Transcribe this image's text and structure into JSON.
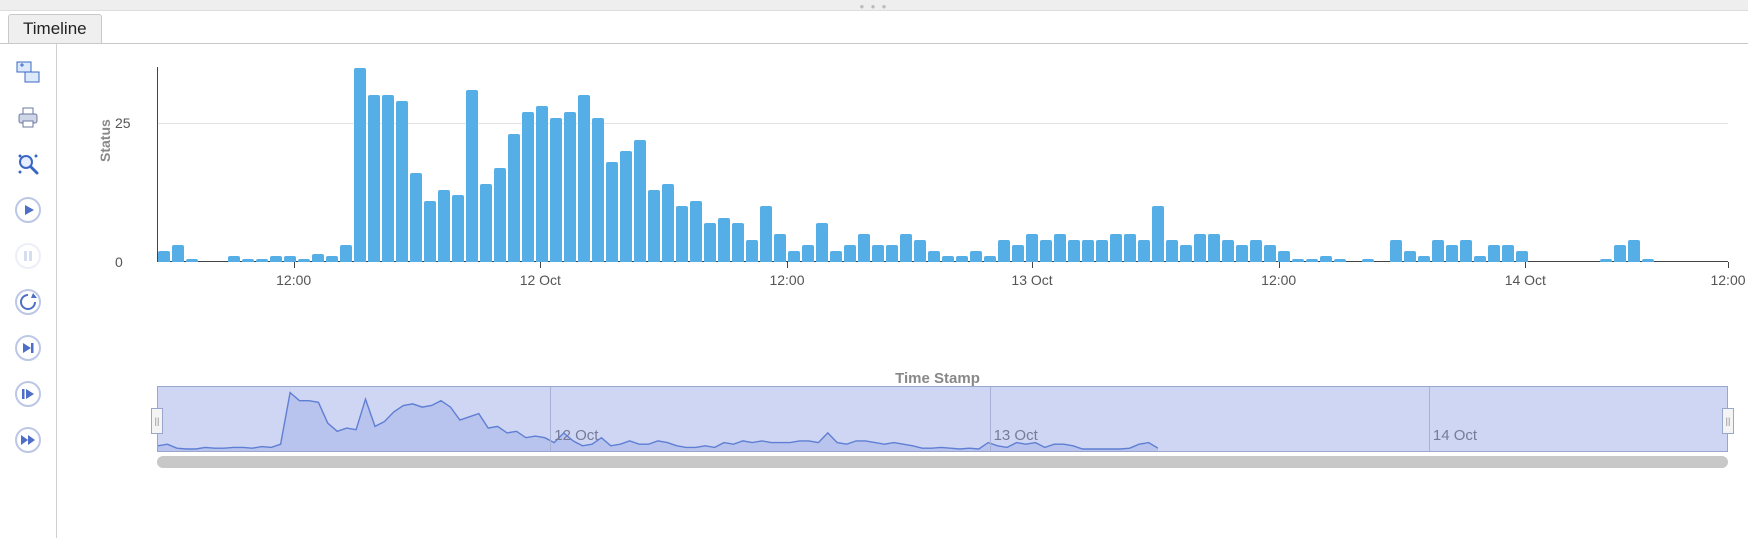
{
  "tab": {
    "label": "Timeline"
  },
  "toolbar": {
    "icons": [
      "screenshot",
      "print",
      "zoom",
      "play",
      "pause",
      "refresh",
      "step-fwd",
      "step-continuous",
      "fast-fwd"
    ]
  },
  "chart_data": {
    "type": "bar",
    "ylabel": "Status",
    "xlabel": "Time Stamp",
    "y_ticks": [
      0,
      25
    ],
    "ylim": [
      0,
      36
    ],
    "x_ticks": [
      {
        "pos_pct": 8.7,
        "label": "12:00"
      },
      {
        "pos_pct": 24.4,
        "label": "12 Oct"
      },
      {
        "pos_pct": 40.1,
        "label": "12:00"
      },
      {
        "pos_pct": 55.7,
        "label": "13 Oct"
      },
      {
        "pos_pct": 71.4,
        "label": "12:00"
      },
      {
        "pos_pct": 87.1,
        "label": "14 Oct"
      },
      {
        "pos_pct": 100.0,
        "label": "12:00"
      }
    ],
    "values": [
      2,
      3,
      0.5,
      0,
      0,
      1,
      0.5,
      0.5,
      1,
      1,
      0.5,
      1.5,
      1,
      3,
      35,
      30,
      30,
      29,
      16,
      11,
      13,
      12,
      31,
      14,
      17,
      23,
      27,
      28,
      26,
      27,
      30,
      26,
      18,
      20,
      22,
      13,
      14,
      10,
      11,
      7,
      8,
      7,
      4,
      10,
      5,
      2,
      3,
      7,
      2,
      3,
      5,
      3,
      3,
      5,
      4,
      2,
      1,
      1,
      2,
      1,
      4,
      3,
      5,
      4,
      5,
      4,
      4,
      4,
      5,
      5,
      4,
      10,
      4,
      3,
      5,
      5,
      4,
      3,
      4,
      3,
      2,
      0.5,
      0.5,
      1,
      0.5,
      0,
      0.5,
      0,
      4,
      2,
      1,
      4,
      3,
      4,
      1,
      3,
      3,
      2,
      0,
      0,
      0,
      0,
      0,
      0.5,
      3,
      4,
      0.5
    ]
  },
  "overview": {
    "ticks": [
      {
        "pos_pct": 25,
        "label": "12 Oct"
      },
      {
        "pos_pct": 53,
        "label": "13 Oct"
      },
      {
        "pos_pct": 81,
        "label": "14 Oct"
      }
    ]
  }
}
